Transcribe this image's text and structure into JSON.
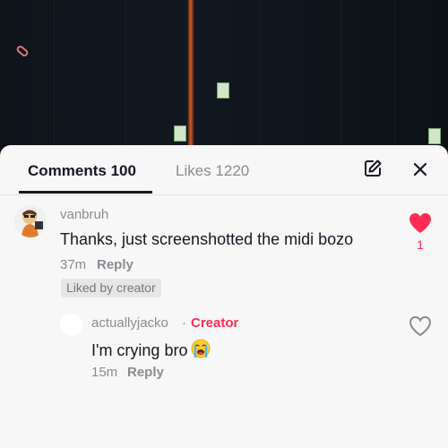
{
  "tabs": {
    "comments_label": "Comments 100",
    "likes_label": "Likes 1220"
  },
  "icons": {
    "edit": "edit-icon",
    "close": "close-icon",
    "heart_filled": "heart-filled-icon",
    "heart_outline": "heart-outline-icon",
    "crying_emoji": "loudly-crying-face-icon",
    "paperclip": "paperclip-icon"
  },
  "colors": {
    "accent": "#fe2c55",
    "text_primary": "#161823",
    "text_secondary": "#8a8b91"
  },
  "comment": {
    "username": "vanbruh",
    "text": "Thanks, just screenshotted the midi bozo",
    "time": "37m",
    "reply_label": "Reply",
    "liked_badge": "Liked by creator",
    "like_count": "1"
  },
  "reply": {
    "username": "actuallyjacko",
    "separator": "·",
    "creator_label": "Creator",
    "text": "I'm crying bro",
    "time": "15m",
    "reply_label": "Reply"
  }
}
